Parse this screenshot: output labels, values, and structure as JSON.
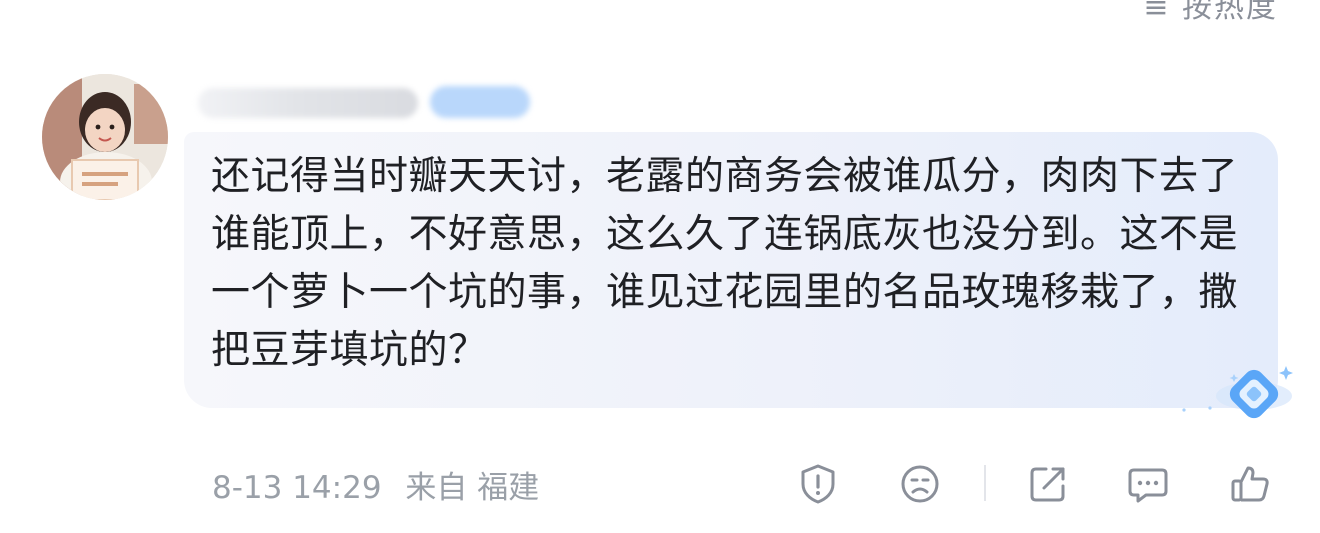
{
  "header": {
    "sort_label": "≡ 按热度"
  },
  "comment": {
    "avatar_icon": "user-avatar-photo",
    "text": "还记得当时瓣天天讨，老露的商务会被谁瓜分，肉肉下去了谁能顶上，不好意思，这么久了连锅底灰也没分到。这不是一个萝卜一个坑的事，谁见过花园里的名品玫瑰移栽了，撒把豆芽填坑的？",
    "meta": {
      "time": "8-13 14:29",
      "location": "来自 福建"
    }
  },
  "actions": [
    {
      "name": "report",
      "icon": "shield-exclamation-icon"
    },
    {
      "name": "dislike",
      "icon": "frown-face-icon"
    },
    {
      "name": "share",
      "icon": "share-arrow-icon"
    },
    {
      "name": "reply",
      "icon": "comment-bubble-icon"
    },
    {
      "name": "like",
      "icon": "thumbs-up-icon"
    }
  ],
  "colors": {
    "text": "#1f2024",
    "meta": "#9aa0a8",
    "icon": "#8a8f99",
    "bubble": "#eef1fa",
    "accent": "#4d9af5"
  }
}
